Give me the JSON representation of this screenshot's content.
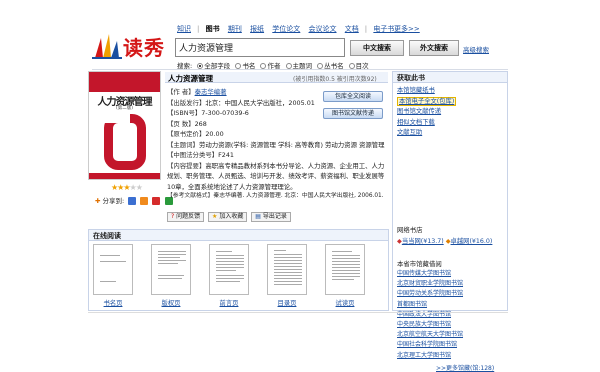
{
  "logo": {
    "text": "读秀"
  },
  "nav": {
    "items": [
      "知识",
      "图书",
      "期刊",
      "报纸",
      "学位论文",
      "会议论文",
      "文档",
      "电子书"
    ],
    "selected": "图书",
    "more": "更多>>"
  },
  "search": {
    "value": "人力资源管理",
    "chinese_button": "中文搜索",
    "foreign_button": "外文搜索",
    "advanced_link": "高级搜索",
    "options_label": "搜索:",
    "options": [
      "全部字段",
      "书名",
      "作者",
      "主题词",
      "丛书名",
      "目次"
    ],
    "selected_option": "全部字段"
  },
  "book": {
    "title": "人力资源管理",
    "stats": "(被引用指数0.5 被引用次数92)",
    "rating_filled": 3,
    "rating_total": 5,
    "share_label": "分享到:",
    "cover": {
      "title": "人力资源管理",
      "subtitle": "(第二版)"
    },
    "lines": [
      {
        "k": "【作 者】",
        "v": "秦志华编著"
      },
      {
        "k": "【出版发行】",
        "v": "北京：中国人民大学出版社，2005.01"
      },
      {
        "k": "【ISBN号】",
        "v": "7-300-07039-6"
      },
      {
        "k": "【页 数】",
        "v": "268"
      },
      {
        "k": "【原书定价】",
        "v": "20.00"
      },
      {
        "k": "【主题词】",
        "v": "劳动力资源(学科: 资源管理 学科: 高等教育) 劳动力资源 资源管理"
      },
      {
        "k": "【中图法分类号】",
        "v": "F241"
      },
      {
        "k": "【内容提要】",
        "v": "高职高专精品教材系列本书分导论、人力资源、企业用工、人力规划、职务管理、人员甄选、培训与开发、绩效考评、薪资福利、职业发展等10章，全面系统地论述了人力资源管理理论。"
      },
      {
        "k": "【参考文献格式】",
        "v": "秦志华编著. 人力资源管理. 北京：中国人民大学出版社, 2006.01."
      }
    ],
    "read_button": "包库全文阅读",
    "library_button": "图书馆文献传递",
    "actions": [
      "问题反馈",
      "加入收藏",
      "导出记录"
    ]
  },
  "get_book": {
    "title": "获取此书",
    "links": [
      "本馆馆藏纸书",
      "本馆电子全文(包库)",
      "图书馆文献传递",
      "相似文档下载",
      "文献互助"
    ],
    "highlighted": "本馆电子全文(包库)",
    "store_title": "网络书店",
    "stores": [
      "当当网(¥13.7)",
      "卓越网(¥16.0)"
    ],
    "libraries_title": "本省市馆藏借阅",
    "libraries": [
      "中国传媒大学图书馆",
      "北京财贸职业学院图书馆",
      "中国劳动关系学院图书馆",
      "首都图书馆",
      "中国政法大学图书馆",
      "中央民族大学图书馆",
      "北京航空航天大学图书馆",
      "中国社会科学院图书馆",
      "北京理工大学图书馆"
    ],
    "more": ">>更多馆藏(馆:128)"
  },
  "online_read": {
    "title": "在线阅读",
    "pages": [
      "书名页",
      "版权页",
      "前言页",
      "目录页",
      "试读页"
    ]
  },
  "colors": {
    "accent": "#1a4fa0",
    "brand": "#d41717",
    "panel": "#eef3fb"
  }
}
